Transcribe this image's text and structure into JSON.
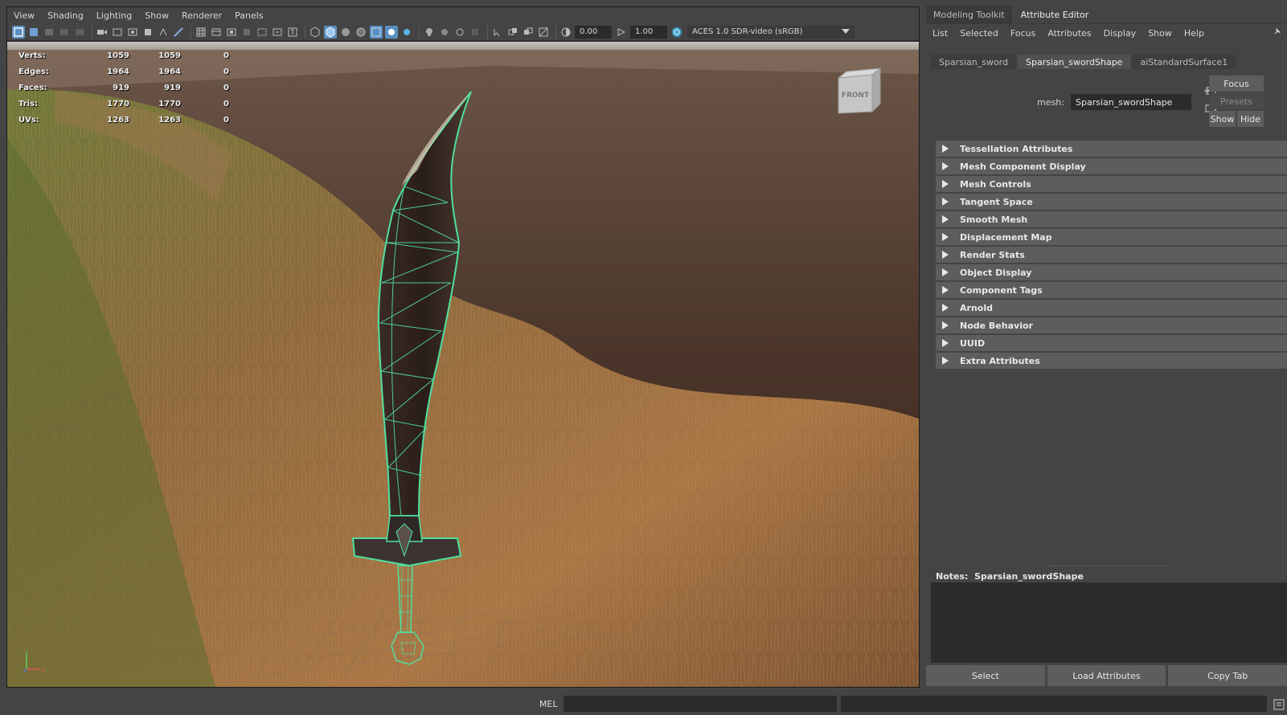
{
  "viewport": {
    "menu": [
      "View",
      "Shading",
      "Lighting",
      "Show",
      "Renderer",
      "Panels"
    ],
    "toolbar": {
      "camera_near": "0.00",
      "camera_far": "1.00",
      "color_space": "ACES 1.0 SDR-video (sRGB)"
    },
    "hud": [
      {
        "label": "Verts:",
        "v1": "1059",
        "v2": "1059",
        "v3": "0"
      },
      {
        "label": "Edges:",
        "v1": "1964",
        "v2": "1964",
        "v3": "0"
      },
      {
        "label": "Faces:",
        "v1": "919",
        "v2": "919",
        "v3": "0"
      },
      {
        "label": "Tris:",
        "v1": "1770",
        "v2": "1770",
        "v3": "0"
      },
      {
        "label": "UVs:",
        "v1": "1263",
        "v2": "1263",
        "v3": "0"
      }
    ],
    "viewcube_label": "FRONT",
    "wireframe_color": "#4fe0a0",
    "axis": {
      "x": "x",
      "y": "y"
    }
  },
  "panel": {
    "tabs": [
      {
        "label": "Modeling Toolkit",
        "active": false
      },
      {
        "label": "Attribute Editor",
        "active": true
      }
    ],
    "menu": [
      "List",
      "Selected",
      "Focus",
      "Attributes",
      "Display",
      "Show",
      "Help"
    ],
    "node_tabs": [
      {
        "label": "Sparsian_sword",
        "active": false
      },
      {
        "label": "Sparsian_swordShape",
        "active": true
      },
      {
        "label": "aiStandardSurface1",
        "active": false
      }
    ],
    "mesh_label": "mesh:",
    "mesh_value": "Sparsian_swordShape",
    "buttons": {
      "focus": "Focus",
      "presets": "Presets",
      "show": "Show",
      "hide": "Hide"
    },
    "sections": [
      "Tessellation Attributes",
      "Mesh Component Display",
      "Mesh Controls",
      "Tangent Space",
      "Smooth Mesh",
      "Displacement Map",
      "Render Stats",
      "Object Display",
      "Component Tags",
      "Arnold",
      "Node Behavior",
      "UUID",
      "Extra Attributes"
    ],
    "notes_label": "Notes:",
    "notes_node": "Sparsian_swordShape",
    "bottom_buttons": [
      "Select",
      "Load Attributes",
      "Copy Tab"
    ]
  },
  "cmdline": {
    "label": "MEL"
  }
}
